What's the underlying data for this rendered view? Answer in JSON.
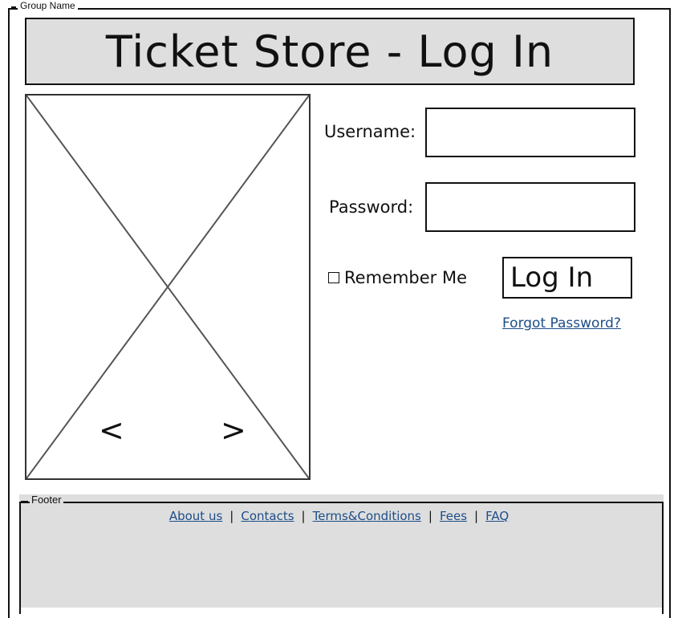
{
  "group": {
    "label": "Group Name"
  },
  "header": {
    "title": "Ticket Store - Log In"
  },
  "image_carousel": {
    "prev_icon": "<",
    "next_icon": ">"
  },
  "form": {
    "username_label": "Username:",
    "password_label": "Password:",
    "username_value": "",
    "password_value": "",
    "remember_label": "Remember Me",
    "login_label": "Log In",
    "forgot_label": "Forgot Password?"
  },
  "footer": {
    "label": "Footer",
    "links": [
      "About us",
      "Contacts",
      "Terms&Conditions",
      "Fees",
      "FAQ"
    ],
    "separator": "|"
  },
  "colors": {
    "panel_bg": "#dedede",
    "link": "#1d4e89",
    "border": "#111111"
  }
}
